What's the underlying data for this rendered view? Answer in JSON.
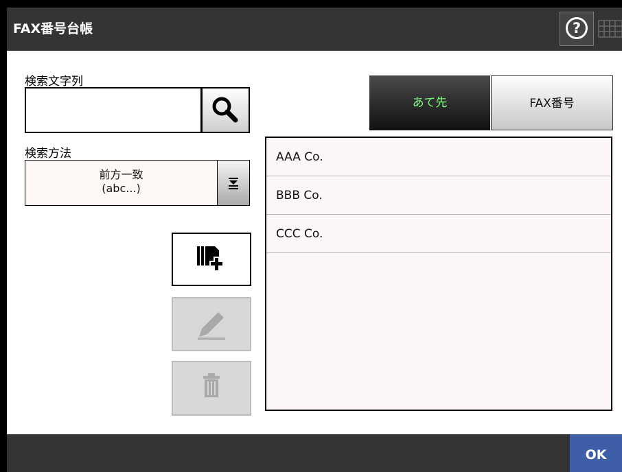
{
  "window": {
    "title": "FAX番号台帳"
  },
  "header": {
    "help_icon": "?",
    "keyboard_icon": "keyboard-icon"
  },
  "search": {
    "label": "検索文字列",
    "value": "",
    "search_icon": "magnifier-icon"
  },
  "method": {
    "label": "検索方法",
    "selected_line1": "前方一致",
    "selected_line2": "(abc...)"
  },
  "actions": {
    "add": {
      "icon": "add-entry-icon",
      "enabled": true
    },
    "edit": {
      "icon": "pencil-icon",
      "enabled": false
    },
    "delete": {
      "icon": "trash-icon",
      "enabled": false
    }
  },
  "tabs": [
    {
      "label": "あて先",
      "active": true
    },
    {
      "label": "FAX番号",
      "active": false
    }
  ],
  "list": {
    "items": [
      "AAA Co.",
      "BBB Co.",
      "CCC Co."
    ]
  },
  "footer": {
    "ok_label": "OK"
  },
  "colors": {
    "titlebar": "#343434",
    "accent": "#3f5ea8",
    "active_tab_text": "#7dff7d"
  }
}
